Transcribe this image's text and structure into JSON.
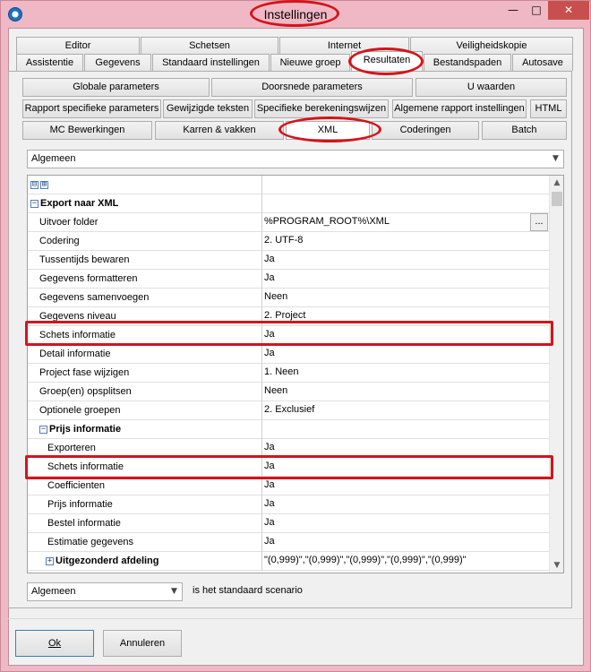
{
  "window": {
    "title": "Instellingen",
    "min_glyph": "—",
    "max_glyph": "□",
    "close_glyph": "✕"
  },
  "tabs_row1": [
    "Editor",
    "Schetsen",
    "Internet",
    "Veiligheidskopie"
  ],
  "tabs_row2": [
    "Assistentie",
    "Gegevens",
    "Standaard instellingen",
    "Nieuwe groep",
    "Resultaten",
    "Bestandspaden",
    "Autosave"
  ],
  "buttons_row1": [
    "Globale parameters",
    "Doorsnede parameters",
    "U waarden"
  ],
  "buttons_row2": [
    "Rapport specifieke parameters",
    "Gewijzigde teksten",
    "Specifieke berekeningswijzen",
    "Algemene rapport instellingen",
    "HTML"
  ],
  "buttons_row3": [
    "MC Bewerkingen",
    "Karren & vakken",
    "XML",
    "Coderingen",
    "Batch"
  ],
  "category_select": {
    "value": "Algemeen"
  },
  "grid": {
    "toolbar": [
      "⊟",
      "⊞"
    ],
    "rows": [
      {
        "name": "Export naar XML",
        "value": ""
      },
      {
        "name": "Uitvoer folder",
        "value": "%PROGRAM_ROOT%\\XML"
      },
      {
        "name": "Codering",
        "value": "2. UTF-8"
      },
      {
        "name": "Tussentijds bewaren",
        "value": "Ja"
      },
      {
        "name": "Gegevens formatteren",
        "value": "Ja"
      },
      {
        "name": "Gegevens samenvoegen",
        "value": "Neen"
      },
      {
        "name": "Gegevens niveau",
        "value": "2. Project"
      },
      {
        "name": "Schets informatie",
        "value": "Ja"
      },
      {
        "name": "Detail informatie",
        "value": "Ja"
      },
      {
        "name": "Project fase wijzigen",
        "value": "1. Neen"
      },
      {
        "name": "Groep(en) opsplitsen",
        "value": "Neen"
      },
      {
        "name": "Optionele groepen",
        "value": "2. Exclusief"
      },
      {
        "name": "Prijs informatie",
        "value": ""
      },
      {
        "name": "Exporteren",
        "value": "Ja"
      },
      {
        "name": "Schets informatie",
        "value": "Ja"
      },
      {
        "name": "Coefficienten",
        "value": "Ja"
      },
      {
        "name": "Prijs informatie",
        "value": "Ja"
      },
      {
        "name": "Bestel informatie",
        "value": "Ja"
      },
      {
        "name": "Estimatie gegevens",
        "value": "Ja"
      },
      {
        "name": "Uitgezonderd afdeling",
        "value": "\"(0,999)\",\"(0,999)\",\"(0,999)\",\"(0,999)\",\"(0,999)\""
      }
    ],
    "ellipsis_label": "..."
  },
  "scenario": {
    "value": "Algemeen",
    "label": "is het standaard scenario"
  },
  "footer": {
    "ok_label": "Ok",
    "cancel_label": "Annuleren"
  }
}
